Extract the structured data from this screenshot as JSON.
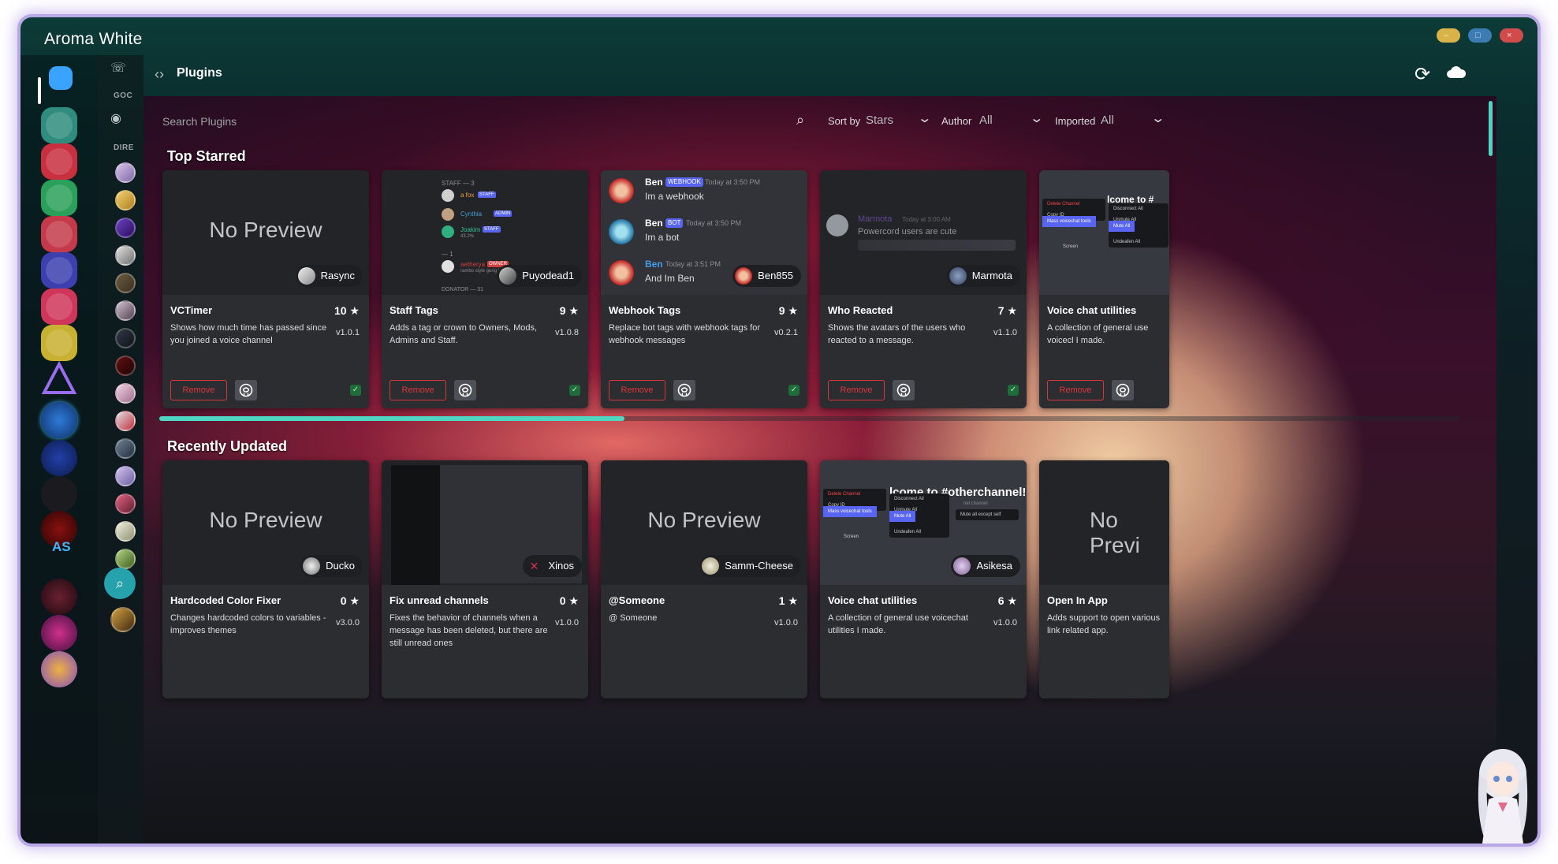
{
  "window": {
    "title": "Aroma White"
  },
  "sidebar": {
    "guild_section_label": "AS",
    "channel_labels": [
      "GOC",
      "DIRE"
    ]
  },
  "topbar": {
    "title": "Plugins"
  },
  "search": {
    "placeholder": "Search Plugins",
    "sort_label": "Sort by",
    "sort_value": "Stars",
    "author_label": "Author",
    "author_value": "All",
    "imported_label": "Imported",
    "imported_value": "All"
  },
  "sections": {
    "top_starred": "Top Starred",
    "recently_updated": "Recently Updated"
  },
  "no_preview_text": "No Preview",
  "remove_label": "Remove",
  "top_starred": [
    {
      "name": "VCTimer",
      "stars": "10 ★",
      "desc": "Shows how much time has passed since you joined a voice channel",
      "version": "v1.0.1",
      "author": "Rasync",
      "preview": "none"
    },
    {
      "name": "Staff Tags",
      "stars": "9 ★",
      "desc": "Adds a tag or crown to Owners, Mods, Admins and Staff.",
      "version": "v1.0.8",
      "author": "Puyodead1",
      "preview": "staff"
    },
    {
      "name": "Webhook Tags",
      "stars": "9 ★",
      "desc": "Replace bot tags with webhook tags for webhook messages",
      "version": "v0.2.1",
      "author": "Ben855",
      "preview": "webhook"
    },
    {
      "name": "Who Reacted",
      "stars": "7 ★",
      "desc": "Shows the avatars of the users who reacted to a message.",
      "version": "v1.1.0",
      "author": "Marmota",
      "preview": "reacted"
    },
    {
      "name": "Voice chat utilities",
      "stars": "",
      "desc": "A collection of general use voicecl I made.",
      "version": "",
      "author": "",
      "preview": "menu"
    }
  ],
  "recently_updated": [
    {
      "name": "Hardcoded Color Fixer",
      "stars": "0 ★",
      "desc": "Changes hardcoded colors to variables - improves themes",
      "version": "v3.0.0",
      "author": "Ducko",
      "preview": "none"
    },
    {
      "name": "Fix unread channels",
      "stars": "0 ★",
      "desc": "Fixes the behavior of channels when a message has been deleted, but there are still unread ones",
      "version": "v1.0.0",
      "author": "Xinos",
      "preview": "screen"
    },
    {
      "name": "@Someone",
      "stars": "1 ★",
      "desc": "@ Someone",
      "version": "v1.0.0",
      "author": "Samm-Cheese",
      "preview": "none"
    },
    {
      "name": "Voice chat utilities",
      "stars": "6 ★",
      "desc": "A collection of general use voicechat utilities I made.",
      "version": "v1.0.0",
      "author": "Asikesa",
      "preview": "menu2"
    },
    {
      "name": "Open In App",
      "stars": "",
      "desc": "Adds support to open various link related app.",
      "version": "",
      "author": "",
      "preview": "none_cut",
      "preview_text": "No Previ"
    }
  ],
  "previews": {
    "staff": {
      "header": "STAFF — 3",
      "rows": [
        {
          "name": "a fox",
          "tag": "STAFF"
        },
        {
          "name": "Cynthia",
          "tag": "ADMIN"
        },
        {
          "name": "Joakim",
          "tag": "STAFF",
          "sub": "43.2%"
        }
      ],
      "divider": "— 1",
      "owner": {
        "name": "aetherya",
        "tag": "OWNER",
        "sub": "rambo style gung ho c"
      },
      "footer": "DONATOR — 31"
    },
    "webhook": [
      {
        "name": "Ben",
        "tag": "WEBHOOK",
        "time": "Today at 3:50 PM",
        "text": "Im a webhook"
      },
      {
        "name": "Ben",
        "tag": "BOT",
        "time": "Today at 3:50 PM",
        "text": "Im a bot"
      },
      {
        "name": "Ben",
        "tag": "",
        "time": "Today at 3:51 PM",
        "text": "And Im Ben"
      }
    ],
    "reacted": {
      "name": "Marmota",
      "time": "Today at 3:00 AM",
      "text": "Powercord users are cute"
    },
    "menu": {
      "title": "lcome to #",
      "left": [
        "Delete Channel",
        "Copy ID",
        "Mass voicechat tools"
      ],
      "right": [
        "Disconnect All",
        "Mute All",
        "Unmute All",
        "Deafen All",
        "Undeafen All"
      ],
      "screen": "Screen"
    },
    "menu2": {
      "title": "lcome to #otherchannel!",
      "left": [
        "Delete Channel",
        "Copy ID",
        "Mass voicechat tools"
      ],
      "right": [
        "Disconnect All",
        "Mute All",
        "Unmute All",
        "Deafen All",
        "Undeafen All"
      ],
      "extra": "Mute all except self",
      "sub": "nel channel",
      "screen": "Screen"
    }
  },
  "colors": {
    "accent": "#4fd6c3",
    "remove": "#da373c",
    "card_bg": "#2b2d31",
    "blurple": "#5865f2"
  }
}
